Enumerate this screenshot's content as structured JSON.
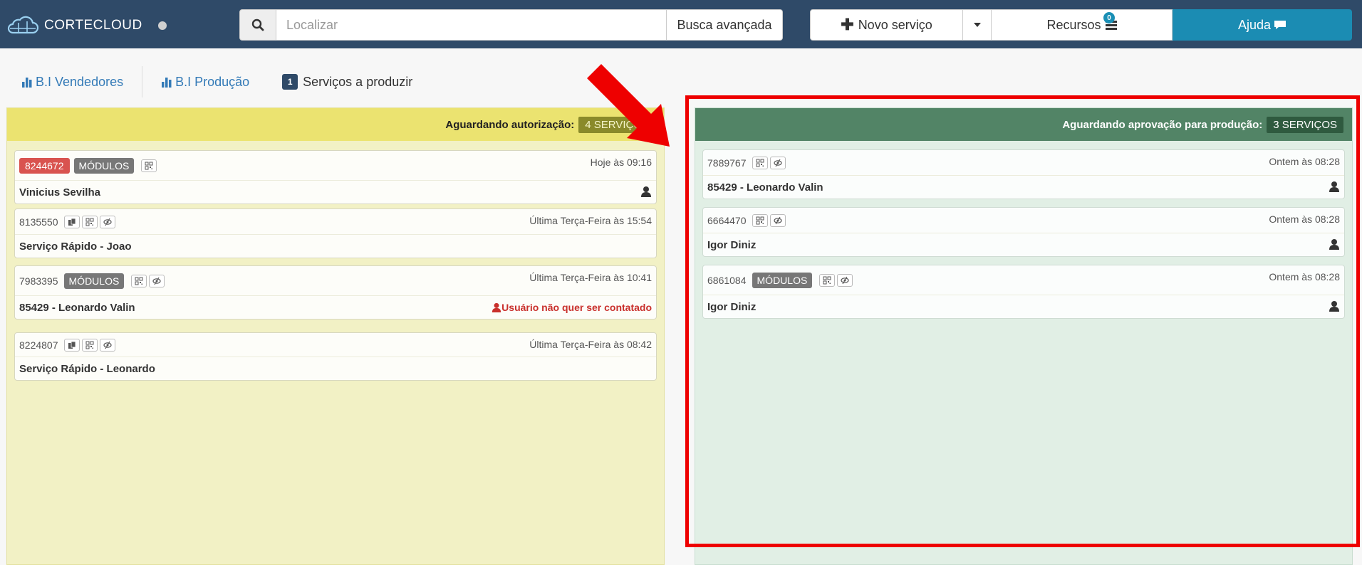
{
  "header": {
    "logo_text": "CORTECLOUD",
    "search_placeholder": "Localizar",
    "advanced_search_label": "Busca avançada",
    "new_service_label": "Novo serviço",
    "resources_label": "Recursos",
    "resources_count": "0",
    "help_label": "Ajuda"
  },
  "tabs": [
    {
      "label": "B.I Vendedores"
    },
    {
      "label": "B.I Produção"
    },
    {
      "badge": "1",
      "label": "Serviços a produzir"
    }
  ],
  "columns": {
    "left": {
      "title": "Aguardando autorização:",
      "badge": "4 SERVIÇOS",
      "cards": [
        {
          "code": "8244672",
          "module": "MÓDULOS",
          "time": "Hoje às 09:16",
          "name": "Vinicius Sevilha"
        },
        {
          "code": "8135550",
          "time": "Última Terça-Feira às 15:54",
          "name": "Serviço Rápido - Joao"
        },
        {
          "code": "7983395",
          "module": "MÓDULOS",
          "time": "Última Terça-Feira às 10:41",
          "name": "85429 - Leonardo Valin",
          "warning": "Usuário não quer ser contatado"
        },
        {
          "code": "8224807",
          "time": "Última Terça-Feira às 08:42",
          "name": "Serviço Rápido - Leonardo"
        }
      ]
    },
    "right": {
      "title": "Aguardando aprovação para produção:",
      "badge": "3 SERVIÇOS",
      "cards": [
        {
          "code": "7889767",
          "time": "Ontem às 08:28",
          "name": "85429 - Leonardo Valin"
        },
        {
          "code": "6664470",
          "time": "Ontem às 08:28",
          "name": "Igor Diniz"
        },
        {
          "code": "6861084",
          "module": "MÓDULOS",
          "time": "Ontem às 08:28",
          "name": "Igor Diniz"
        }
      ]
    }
  },
  "colors": {
    "topbar": "#2f4a68",
    "help_button": "#1b8cb3",
    "left_header": "#ebe370",
    "right_header": "#528466",
    "annotation_red": "#ee0000"
  }
}
